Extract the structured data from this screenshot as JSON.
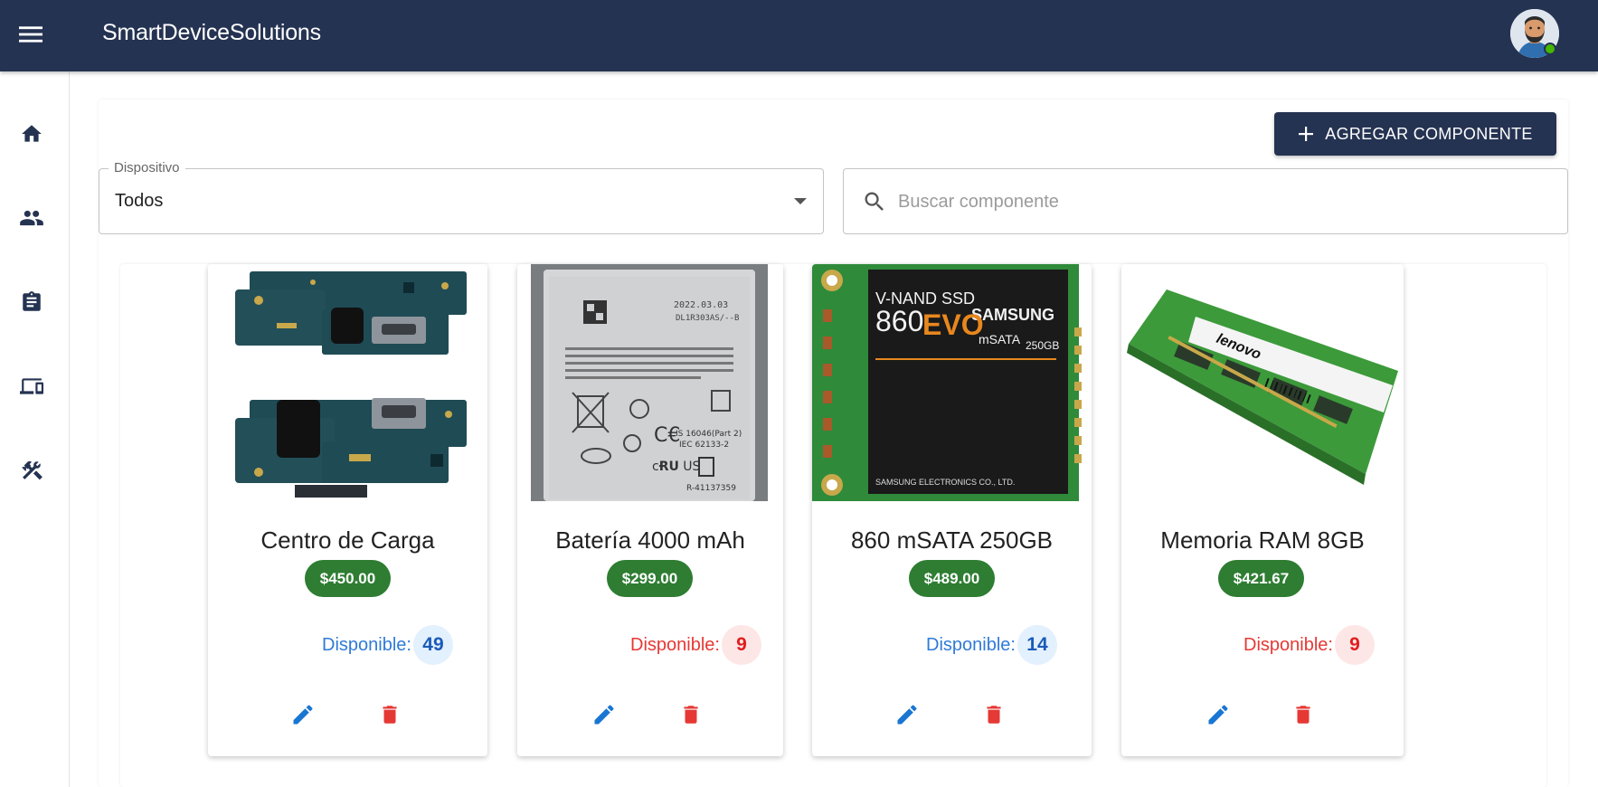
{
  "appbar": {
    "title": "SmartDeviceSolutions"
  },
  "toolbar": {
    "add_label": "AGREGAR COMPONENTE"
  },
  "filters": {
    "device_label": "Dispositivo",
    "device_value": "Todos",
    "search_placeholder": "Buscar componente"
  },
  "products": [
    {
      "name": "Centro de Carga",
      "price": "$450.00",
      "stock_label": "Disponible:",
      "stock": "49",
      "stock_level": "ok"
    },
    {
      "name": "Batería 4000 mAh",
      "price": "$299.00",
      "stock_label": "Disponible:",
      "stock": "9",
      "stock_level": "low"
    },
    {
      "name": "860 mSATA 250GB",
      "price": "$489.00",
      "stock_label": "Disponible:",
      "stock": "14",
      "stock_level": "ok"
    },
    {
      "name": "Memoria RAM 8GB",
      "price": "$421.67",
      "stock_label": "Disponible:",
      "stock": "9",
      "stock_level": "low"
    }
  ],
  "product_image_text": {
    "battery_date": "2022.03.03",
    "battery_code": "DL1R303AS/--B",
    "ssd_line1": "V-NAND SSD",
    "ssd_brand": "SAMSUNG",
    "ssd_model": "860",
    "ssd_model_suffix": "EVO",
    "ssd_type": "mSATA",
    "ssd_capacity": "250GB",
    "ssd_maker": "SAMSUNG ELECTRONICS CO., LTD.",
    "ram_brand": "lenovo"
  },
  "colors": {
    "appbar": "#253352",
    "price_badge": "#2e7d32",
    "stock_ok": "#2f7bd9",
    "stock_low": "#e53935",
    "action_edit": "#1976d2",
    "action_delete": "#e53935"
  },
  "icons": {
    "nav": [
      "home-icon",
      "people-icon",
      "clipboard-icon",
      "devices-icon",
      "tools-icon"
    ]
  }
}
